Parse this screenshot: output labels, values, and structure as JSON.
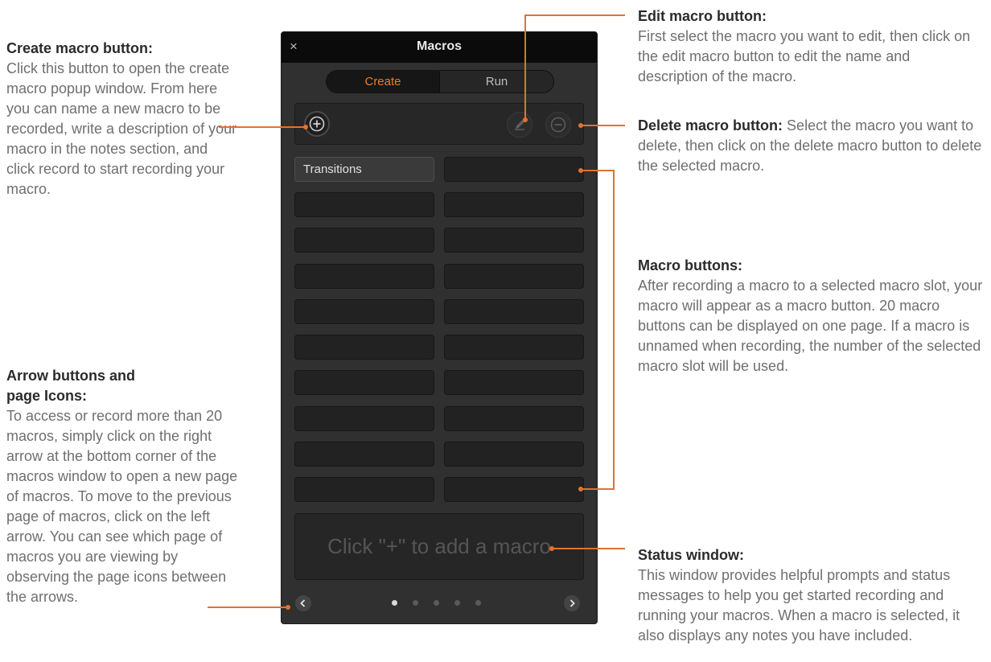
{
  "window": {
    "title": "Macros",
    "close_glyph": "×"
  },
  "tabs": [
    {
      "label": "Create",
      "active": true
    },
    {
      "label": "Run",
      "active": false
    }
  ],
  "toolbar": {
    "add_icon": "add-circle-icon",
    "edit_icon": "pencil-icon",
    "delete_icon": "minus-circle-icon"
  },
  "macros": {
    "slot1_label": "Transitions"
  },
  "status": {
    "text": "Click \"+\" to add a macro"
  },
  "pagination": {
    "pages": 5,
    "current": 1
  },
  "colors": {
    "accent": "#e0732f",
    "panel": "#303030"
  },
  "callouts": {
    "create": {
      "heading": "Create macro button:",
      "body": "Click this button to open the create macro popup window. From here you can name a new macro to be recorded, write a description of your macro in the notes section, and click record to start recording your macro."
    },
    "arrows": {
      "heading": "Arrow buttons and page Icons:",
      "body": "To access or record more than 20 macros, simply click on the right arrow at the bottom corner of the macros window to open a new page of macros. To move to the previous page of macros, click on the left arrow. You can see which page of macros you are viewing by observing the page icons between the arrows."
    },
    "edit": {
      "heading": "Edit macro button:",
      "body": "First select the macro you want to edit, then click on the edit macro button to edit the name and description of the macro."
    },
    "delete": {
      "heading": "Delete macro button:",
      "body": "Select the macro you want to delete, then click on the delete macro button to delete the selected macro."
    },
    "macro_buttons": {
      "heading": "Macro buttons:",
      "body": "After recording a macro to a selected macro slot, your macro will appear as a macro button. 20 macro buttons can be displayed on one page. If a macro is unnamed when recording, the number of the selected macro slot will be used."
    },
    "status": {
      "heading": "Status window:",
      "body": "This window provides helpful prompts and status messages to help you get started recording and running your macros. When a macro is selected, it also displays any notes you have included."
    }
  }
}
